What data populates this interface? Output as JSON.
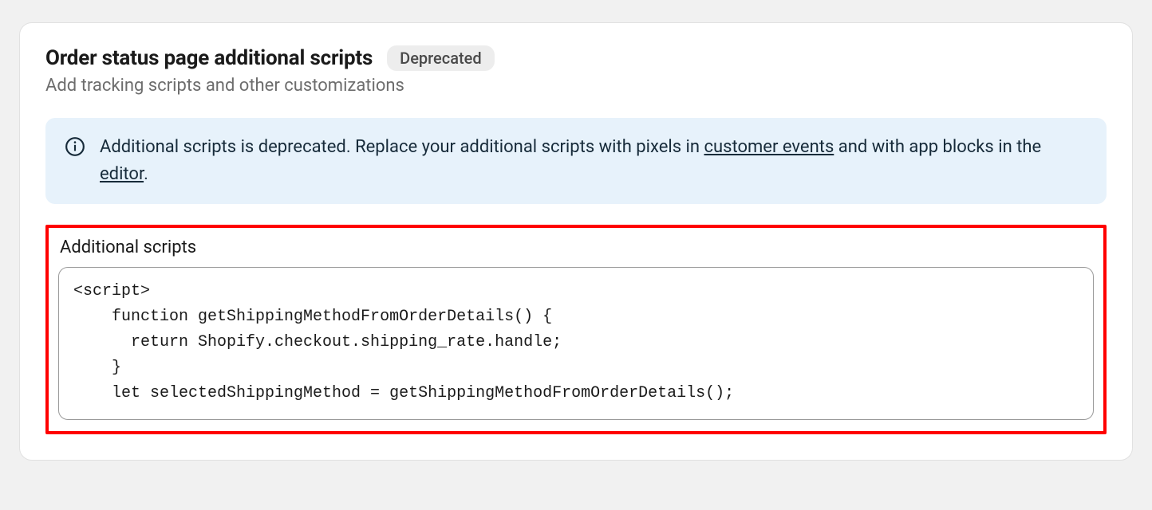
{
  "section": {
    "title": "Order status page additional scripts",
    "badge": "Deprecated",
    "subtitle": "Add tracking scripts and other customizations"
  },
  "banner": {
    "text_1": "Additional scripts is deprecated. Replace your additional scripts with pixels in ",
    "link_1": "customer events",
    "text_2": " and with app blocks in the ",
    "link_2": "editor",
    "text_3": "."
  },
  "field": {
    "label": "Additional scripts",
    "value": "<script>\n    function getShippingMethodFromOrderDetails() {\n      return Shopify.checkout.shipping_rate.handle;\n    }\n    let selectedShippingMethod = getShippingMethodFromOrderDetails();"
  }
}
